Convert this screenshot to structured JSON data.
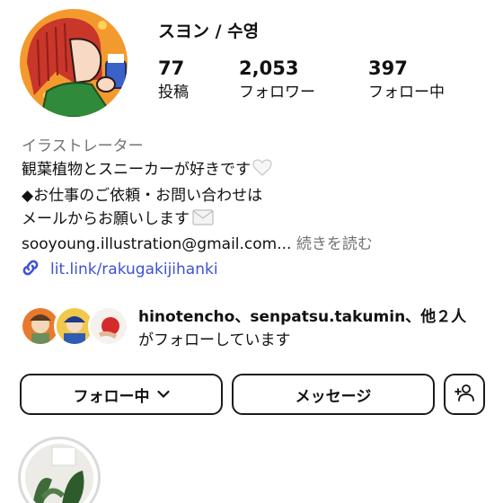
{
  "profile": {
    "username": "スヨン / 수영",
    "stats": [
      {
        "value": "77",
        "label": "投稿"
      },
      {
        "value": "2,053",
        "label": "フォロワー"
      },
      {
        "value": "397",
        "label": "フォロー中"
      }
    ]
  },
  "bio": {
    "category": "イラストレーター",
    "line1": "観葉植物とスニーカーが好きです",
    "line2": "◆お仕事のご依頼・お問い合わせは",
    "line3": "メールからお願いします",
    "email": "sooyoung.illustration@gmail.com...",
    "more": "続きを読む",
    "heart_icon": "white-heart-icon",
    "envelope_icon": "envelope-icon"
  },
  "link": {
    "text": "lit.link/rakugakijihanki",
    "icon": "link-icon",
    "color": "#3d52d5"
  },
  "followed_by": {
    "names": "hinotencho、senpatsu.takumin、",
    "rest": "他２人",
    "line2": "がフォローしています"
  },
  "buttons": {
    "following": "フォロー中",
    "message": "メッセージ",
    "add_person_icon": "add-person-icon"
  }
}
